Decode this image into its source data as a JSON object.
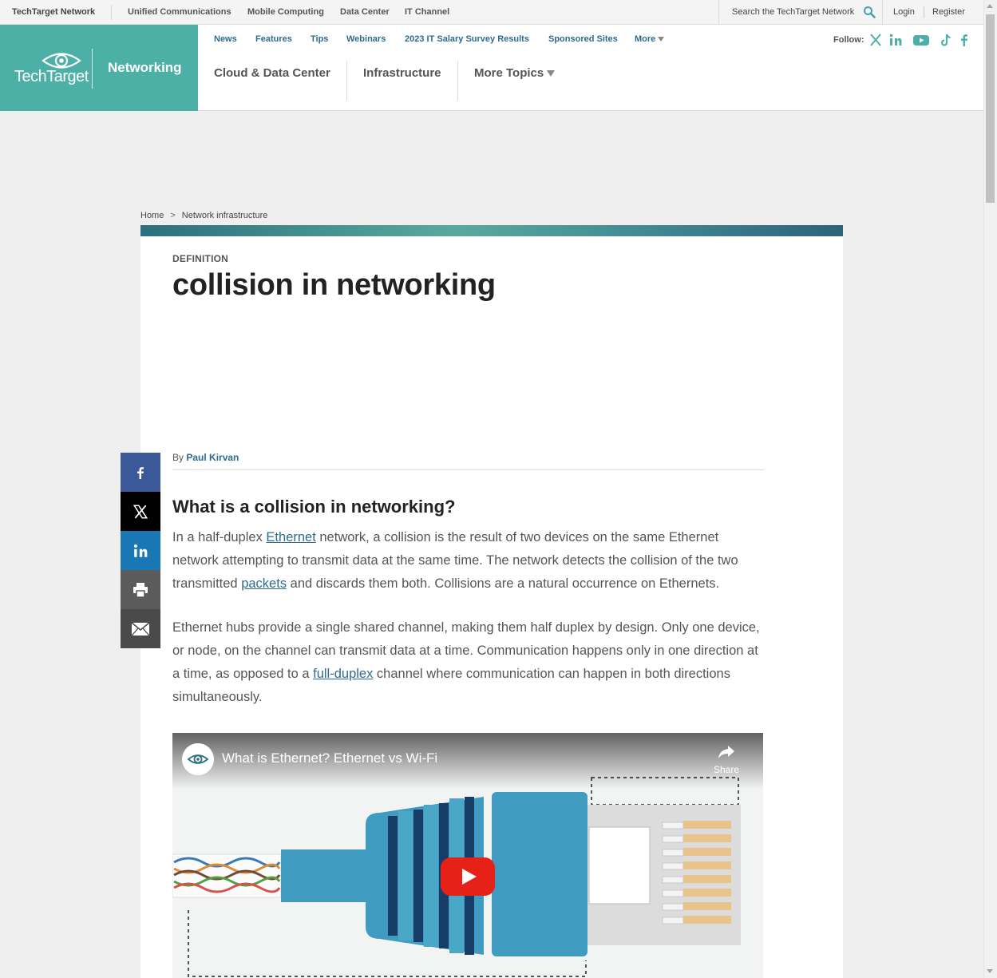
{
  "netbar": {
    "brand": "TechTarget Network",
    "links": [
      "Unified Communications",
      "Mobile Computing",
      "Data Center",
      "IT Channel"
    ],
    "search_placeholder": "Search the TechTarget Network",
    "login": "Login",
    "register": "Register"
  },
  "header": {
    "logo_text": "TechTarget",
    "site_name": "Networking",
    "subnav": [
      "News",
      "Features",
      "Tips",
      "Webinars",
      "2023 IT Salary Survey Results",
      "Sponsored Sites",
      "More"
    ],
    "topics": [
      "Cloud & Data Center",
      "Infrastructure",
      "More Topics"
    ],
    "follow_label": "Follow:",
    "social_icons": [
      "x-icon",
      "linkedin-icon",
      "youtube-icon",
      "tiktok-icon",
      "facebook-icon"
    ]
  },
  "breadcrumb": {
    "home": "Home",
    "separator": ">",
    "section": "Network infrastructure"
  },
  "article": {
    "kicker": "DEFINITION",
    "title": "collision in networking",
    "by": "By",
    "author": "Paul Kirvan",
    "heading": "What is a collision in networking?",
    "p1": {
      "t1": "In a half-duplex ",
      "l1": "Ethernet",
      "t2": " network, a collision is the result of two devices on the same Ethernet network attempting to transmit data at the same time. The network detects the collision of the two transmitted ",
      "l2": "packets",
      "t3": " and discards them both. Collisions are a natural occurrence on Ethernets."
    },
    "p2": {
      "t1": "Ethernet hubs provide a single shared channel, making them half duplex by design. Only one device, or node, on the channel can transmit data at a time. Communication happens only in one direction at a time, as opposed to a ",
      "l1": "full-duplex",
      "t2": " channel where communication can happen in both directions simultaneously."
    }
  },
  "video": {
    "title": "What is Ethernet? Ethernet vs Wi-Fi",
    "share": "Share"
  },
  "share_rail": [
    "facebook-icon",
    "x-icon",
    "linkedin-icon",
    "print-icon",
    "email-icon"
  ],
  "colors": {
    "brand_teal": "#4db0a7",
    "link_blue": "#2e6b8e",
    "youtube_red": "#e62117"
  }
}
